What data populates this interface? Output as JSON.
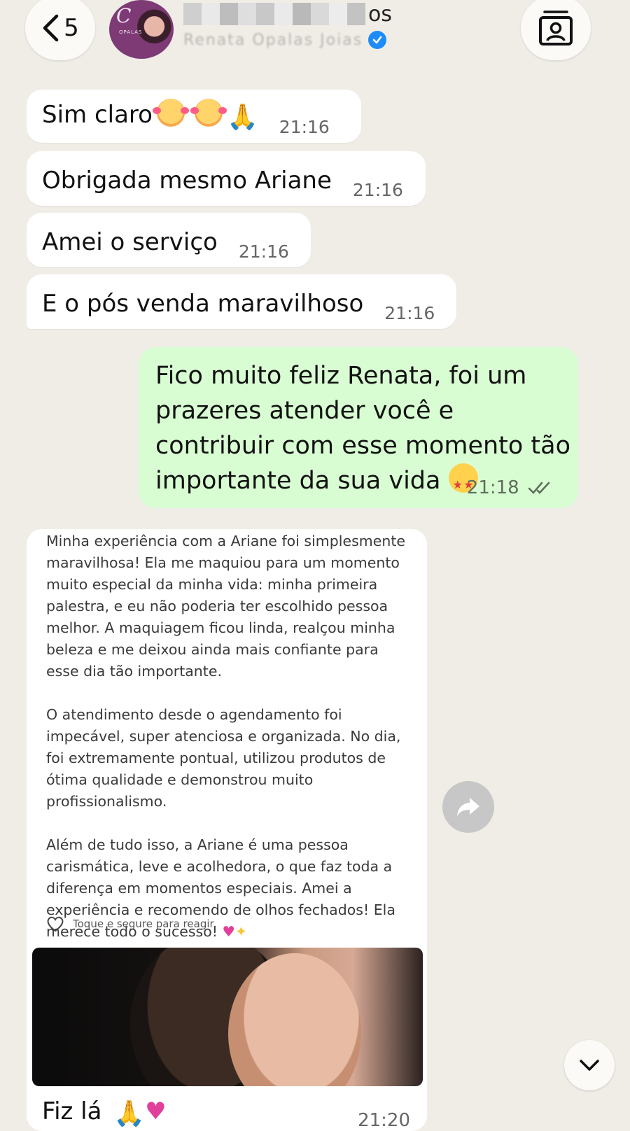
{
  "header": {
    "back_count": "5",
    "contact_name_visible_tail": "os",
    "contact_subtitle": "Renata Opalas Joias",
    "avatar_logo": "C",
    "avatar_logo_sub": "OPALAS"
  },
  "messages": {
    "m1": {
      "text": "Sim claro",
      "time": "21:16"
    },
    "m2": {
      "text": "Obrigada mesmo Ariane",
      "time": "21:16"
    },
    "m3": {
      "text": "Amei o serviço",
      "time": "21:16"
    },
    "m4": {
      "text": "E o pós venda maravilhoso",
      "time": "21:16"
    },
    "out": {
      "text": "Fico muito feliz Renata, foi um prazeres atender você e contribuir com esse momento tão importante da sua vida",
      "time": "21:18"
    }
  },
  "card": {
    "review_p1": "Minha experiência com a Ariane foi simplesmente maravilhosa! Ela me maquiou para um momento muito especial da minha vida: minha primeira palestra, e eu não poderia ter escolhido pessoa melhor. A maquiagem ficou linda, realçou minha beleza e me deixou ainda mais confiante para esse dia tão importante.",
    "review_p2": "O atendimento desde o agendamento foi impecável, super atenciosa e organizada. No dia, foi extremamente pontual, utilizou produtos de ótima qualidade e demonstrou muito profissionalismo.",
    "review_p3": "Além de tudo isso, a Ariane é uma pessoa carismática, leve e acolhedora, o que faz toda a diferença em momentos especiais. Amei a experiência e recomendo de olhos fechados! Ela merece todo o sucesso!",
    "react_hint": "Toque e segure para reagir",
    "caption": "Fiz lá",
    "time": "21:20"
  },
  "colors": {
    "background": "#f0ede7",
    "incoming_bubble": "#ffffff",
    "outgoing_bubble": "#d9fdd3",
    "verified": "#1d8cf8"
  },
  "icons": [
    "chevron-left-icon",
    "contact-card-icon",
    "verified-badge-icon",
    "double-check-icon",
    "heart-outline-icon",
    "forward-arrow-icon",
    "chevron-down-icon"
  ]
}
